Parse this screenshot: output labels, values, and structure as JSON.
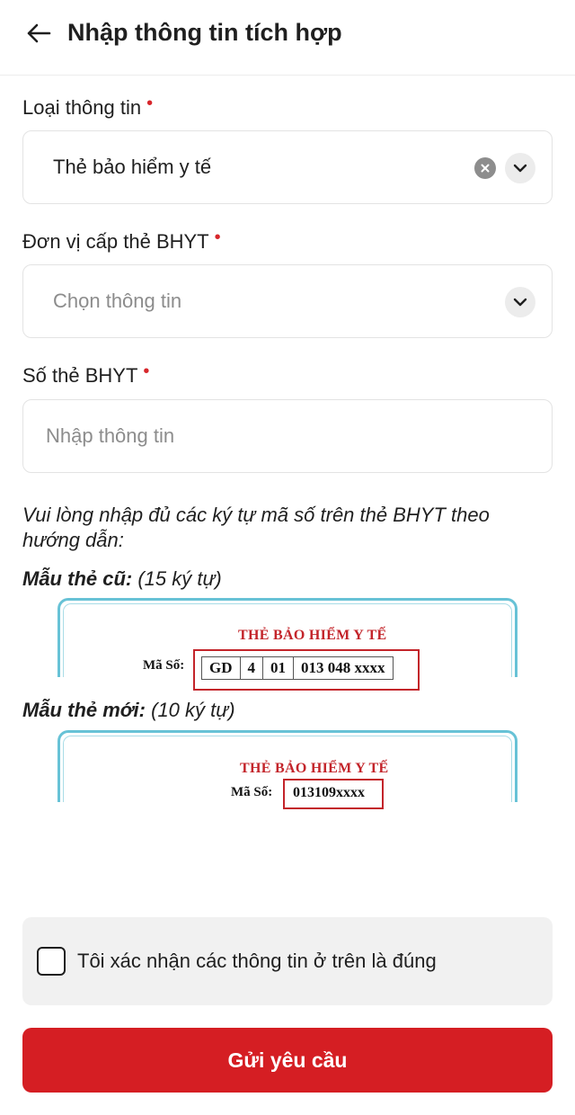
{
  "header": {
    "title": "Nhập thông tin tích hợp",
    "back_icon": "arrow-left-icon"
  },
  "form": {
    "required_mark": "•",
    "info_type": {
      "label": "Loại thông tin",
      "value": "Thẻ bảo hiểm y tế"
    },
    "issuer": {
      "label": "Đơn vị cấp thẻ BHYT",
      "placeholder": "Chọn thông tin"
    },
    "card_number": {
      "label": "Số thẻ BHYT",
      "placeholder": "Nhập thông tin"
    }
  },
  "hint": "Vui lòng nhập đủ các ký tự mã số trên thẻ BHYT theo hướng dẫn:",
  "samples": {
    "old": {
      "label_bold": "Mẫu thẻ cũ:",
      "label_rest": " (15 ký tự)",
      "card_title": "THẺ BẢO HIỂM Y TẾ",
      "ma_so": "Mã Số:",
      "code_parts": [
        "GD",
        "4",
        "01",
        "013 048 xxxx"
      ]
    },
    "new": {
      "label_bold": "Mẫu thẻ mới:",
      "label_rest": " (10 ký tự)",
      "card_title": "THẺ BẢO HIỂM Y TẾ",
      "ma_so": "Mã Số:",
      "code": "013109xxxx"
    }
  },
  "confirm": {
    "label": "Tôi xác nhận các thông tin ở trên là đúng",
    "checked": false
  },
  "submit_label": "Gửi yêu cầu",
  "colors": {
    "primary": "#d51e23",
    "required": "#d7262b",
    "card_frame": "#67c2d6"
  }
}
